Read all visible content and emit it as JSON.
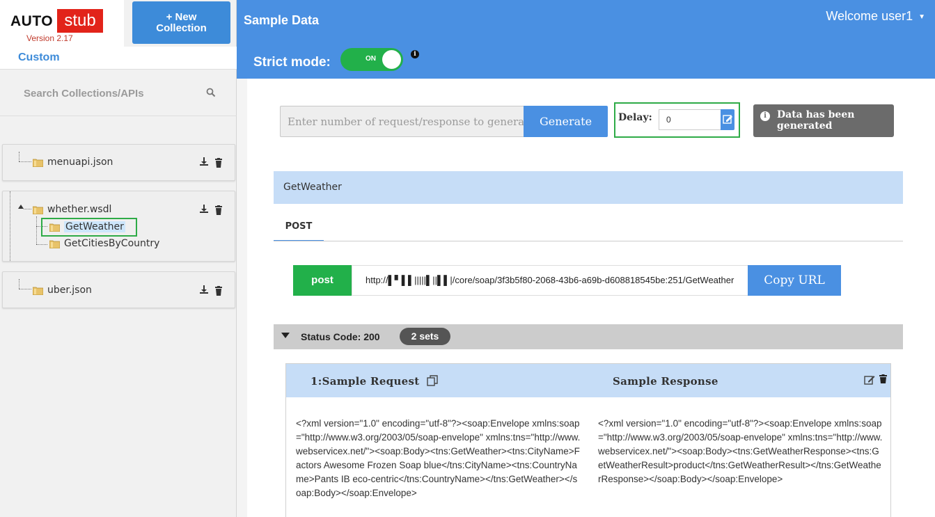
{
  "logo": {
    "part1": "AUTO",
    "part2": "stub",
    "version": "Version 2.17"
  },
  "sidebar": {
    "new_collection_line1": "+ New",
    "new_collection_line2": "Collection",
    "section_label": "Custom",
    "search": {
      "placeholder": "Search Collections/APIs",
      "value": ""
    },
    "collections": [
      {
        "name": "menuapi.json",
        "children": []
      },
      {
        "name": "whether.wsdl",
        "expanded": true,
        "children": [
          {
            "name": "GetWeather",
            "selected": true
          },
          {
            "name": "GetCitiesByCountry",
            "selected": false
          }
        ]
      },
      {
        "name": "uber.json",
        "children": []
      }
    ]
  },
  "header": {
    "title": "Sample Data",
    "welcome": "Welcome user1",
    "strict_mode_label": "Strict mode:",
    "strict_toggle_text": "ON",
    "strict_mode_on": true
  },
  "generate": {
    "placeholder": "Enter number of request/response to generate",
    "value": "",
    "button_label": "Generate"
  },
  "delay": {
    "label": "Delay:",
    "value": "0"
  },
  "toast": {
    "message": "Data has been generated"
  },
  "api": {
    "name": "GetWeather",
    "method_tab": "POST",
    "method_badge": "post",
    "url": "http://▌▘▌▌|||||▌||▌▌|/core/soap/3f3b5f80-2068-43b6-a69b-d608818545be:251/GetWeather",
    "copy_button": "Copy URL"
  },
  "status": {
    "text": "Status Code: 200",
    "sets": "2 sets"
  },
  "sample": {
    "request_title": "1:Sample Request",
    "response_title": "Sample Response",
    "request_body": "<?xml version=\"1.0\" encoding=\"utf-8\"?><soap:Envelope xmlns:soap=\"http://www.w3.org/2003/05/soap-envelope\" xmlns:tns=\"http://www.webservicex.net/\"><soap:Body><tns:GetWeather><tns:CityName>Factors Awesome Frozen Soap blue</tns:CityName><tns:CountryName>Pants IB eco-centric</tns:CountryName></tns:GetWeather></soap:Body></soap:Envelope>",
    "response_body": "<?xml version=\"1.0\" encoding=\"utf-8\"?><soap:Envelope xmlns:soap=\"http://www.w3.org/2003/05/soap-envelope\" xmlns:tns=\"http://www.webservicex.net/\"><soap:Body><tns:GetWeatherResponse><tns:GetWeatherResult>product</tns:GetWeatherResult></tns:GetWeatherResponse></soap:Body></soap:Envelope>"
  },
  "colors": {
    "header_blue": "#4a90e2",
    "success_green": "#22b04a",
    "brand_red": "#e2231a"
  },
  "icons": [
    "search-icon",
    "folder-icon",
    "download-icon",
    "trash-icon",
    "info-icon",
    "edit-icon",
    "copy-icon",
    "chevron-down-icon"
  ]
}
